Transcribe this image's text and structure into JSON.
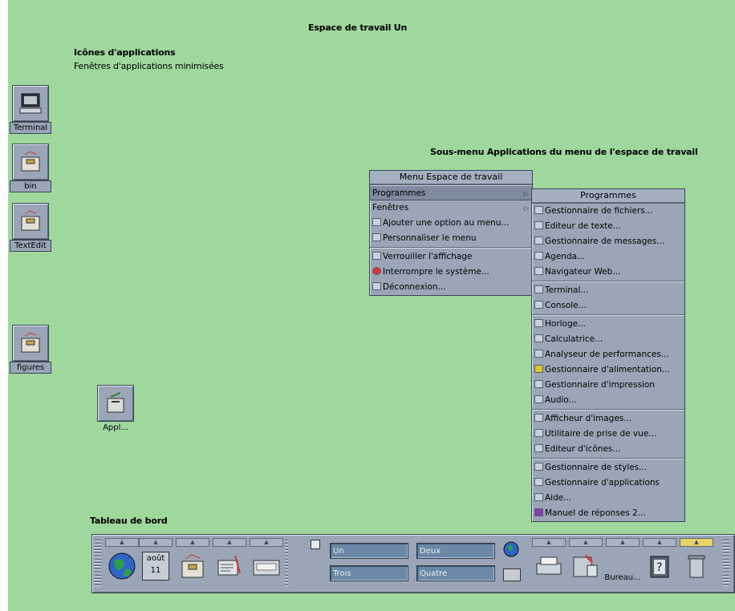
{
  "captions": {
    "workspace_title": "Espace de travail Un",
    "app_icons": "Icônes d'applications",
    "minimized_windows": "Fenêtres d'applications minimisées",
    "submenu_caption": "Sous-menu Applications du menu de l'espace de travail",
    "panel_caption": "Tableau de bord"
  },
  "desktop_icons": [
    {
      "label": "Terminal"
    },
    {
      "label": "bin"
    },
    {
      "label": "TextEdit"
    },
    {
      "label": "figures"
    },
    {
      "label": "Appl..."
    }
  ],
  "workspace_menu": {
    "title": "Menu Espace de travail",
    "items": [
      {
        "label": "Programmes",
        "submenu": true,
        "selected": true
      },
      {
        "label": "Fenêtres",
        "submenu": true
      },
      {
        "label": "Ajouter une option au menu..."
      },
      {
        "label": "Personnaliser le menu"
      },
      {
        "label": "Verrouiller l'affichage"
      },
      {
        "label": "Interrompre le système..."
      },
      {
        "label": "Déconnexion..."
      }
    ]
  },
  "programs_menu": {
    "title": "Programmes",
    "groups": [
      [
        "Gestionnaire de fichiers...",
        "Editeur de texte...",
        "Gestionnaire de messages...",
        "Agenda...",
        "Navigateur Web..."
      ],
      [
        "Terminal...",
        "Console..."
      ],
      [
        "Horloge...",
        "Calculatrice...",
        "Analyseur de performances...",
        "Gestionnaire d'alimentation...",
        "Gestionnaire d'impression",
        "Audio..."
      ],
      [
        "Afficheur d'images...",
        "Utilitaire de prise de vue...",
        "Editeur d'icônes..."
      ],
      [
        "Gestionnaire de styles...",
        "Gestionnaire d'applications",
        "Aide...",
        "Manuel de réponses 2..."
      ]
    ]
  },
  "panel": {
    "calendar_month": "août",
    "calendar_day": "11",
    "workspaces": [
      "Un",
      "Deux",
      "Trois",
      "Quatre"
    ],
    "desk_label": "Bureau..."
  },
  "colors": {
    "desktop": "#9fd89c",
    "chrome": "#9aa6b8",
    "workspace_button": "#6b88a8"
  }
}
